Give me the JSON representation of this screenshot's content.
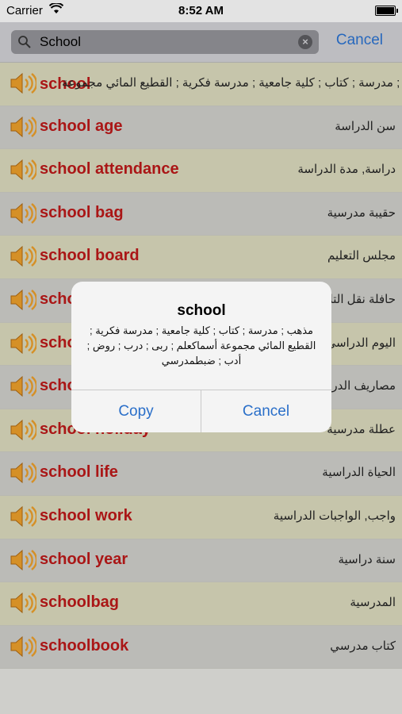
{
  "status_bar": {
    "carrier": "Carrier",
    "time": "8:52 AM",
    "battery_level": 1.0
  },
  "search": {
    "query": "School",
    "clear_icon": "clear-icon",
    "cancel_label": "Cancel"
  },
  "entries": [
    {
      "word": "school",
      "translation": "مذهب ; مدرسة ; كتاب ; كلية جامعية ; مدرسة فكرية ; القطيع المائي مجموعة"
    },
    {
      "word": "school age",
      "translation": "سن الدراسة"
    },
    {
      "word": "school attendance",
      "translation": "دراسة, مدة الدراسة"
    },
    {
      "word": "school bag",
      "translation": "حقيبة مدرسية"
    },
    {
      "word": "school board",
      "translation": "مجلس التعليم"
    },
    {
      "word": "school bus",
      "translation": "حافلة نقل التلاميذ"
    },
    {
      "word": "school day",
      "translation": "اليوم الدراسي"
    },
    {
      "word": "school fees",
      "translation": "مصاريف الدراسة"
    },
    {
      "word": "school holiday",
      "translation": "عطلة مدرسية"
    },
    {
      "word": "school life",
      "translation": "الحياة الدراسية"
    },
    {
      "word": "school work",
      "translation": "واجب, الواجبات الدراسية"
    },
    {
      "word": "school year",
      "translation": "سنة دراسية"
    },
    {
      "word": "schoolbag",
      "translation": "المدرسية"
    },
    {
      "word": "schoolbook",
      "translation": "كتاب مدرسي"
    }
  ],
  "dialog": {
    "title": "school",
    "message": "مذهب ; مدرسة ; كتاب ; كلية جامعية ; مدرسة فكرية ; القطيع المائي مجموعة أسماكعلم ; ربى ; درب ; روض ; أدب ; ضبطمدرسي",
    "copy_label": "Copy",
    "cancel_label": "Cancel"
  },
  "colors": {
    "word": "#b51818",
    "accent": "#2a6fc9",
    "row_odd": "#d3d2b6",
    "row_even": "#c7c7c3"
  }
}
